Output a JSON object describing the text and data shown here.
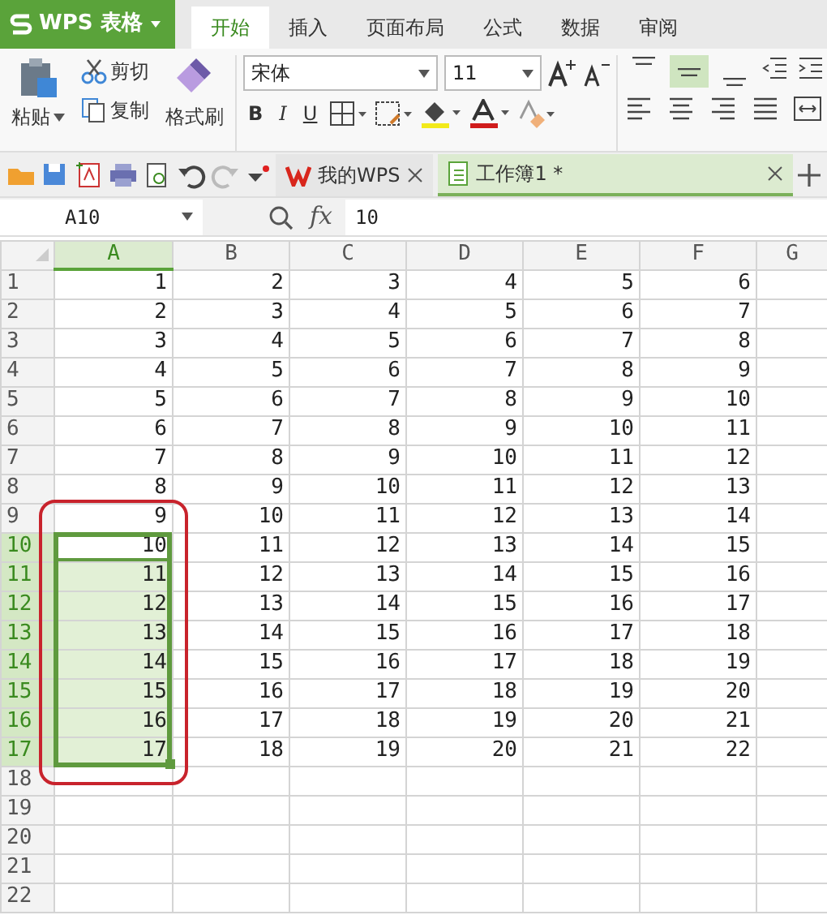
{
  "app_menu": {
    "label": "WPS 表格"
  },
  "ribbon_tabs": [
    {
      "label": "开始",
      "selected": true
    },
    {
      "label": "插入",
      "selected": false
    },
    {
      "label": "页面布局",
      "selected": false
    },
    {
      "label": "公式",
      "selected": false
    },
    {
      "label": "数据",
      "selected": false
    },
    {
      "label": "审阅",
      "selected": false
    }
  ],
  "clipboard": {
    "paste": "粘贴",
    "cut": "剪切",
    "copy": "复制",
    "format_painter": "格式刷"
  },
  "font": {
    "name": "宋体",
    "size": "11",
    "bold": "B",
    "italic": "I",
    "underline": "U"
  },
  "vertical_align": [
    {
      "kind": "top",
      "selected": false
    },
    {
      "kind": "middle",
      "selected": true
    },
    {
      "kind": "bottom",
      "selected": false
    }
  ],
  "doc_tabs": [
    {
      "label": "我的WPS",
      "selected": false
    },
    {
      "label": "工作簿1 *",
      "selected": true
    }
  ],
  "formula_bar": {
    "name_box": "A10",
    "fx": "fx",
    "value": "10"
  },
  "sheet": {
    "columns": [
      {
        "label": "A",
        "selected": true
      },
      {
        "label": "B",
        "selected": false
      },
      {
        "label": "C",
        "selected": false
      },
      {
        "label": "D",
        "selected": false
      },
      {
        "label": "E",
        "selected": false
      },
      {
        "label": "F",
        "selected": false
      },
      {
        "label": "G",
        "selected": false
      }
    ],
    "rows": [
      {
        "number": "1",
        "selected": false,
        "cells": [
          "1",
          "2",
          "3",
          "4",
          "5",
          "6"
        ]
      },
      {
        "number": "2",
        "selected": false,
        "cells": [
          "2",
          "3",
          "4",
          "5",
          "6",
          "7"
        ]
      },
      {
        "number": "3",
        "selected": false,
        "cells": [
          "3",
          "4",
          "5",
          "6",
          "7",
          "8"
        ]
      },
      {
        "number": "4",
        "selected": false,
        "cells": [
          "4",
          "5",
          "6",
          "7",
          "8",
          "9"
        ]
      },
      {
        "number": "5",
        "selected": false,
        "cells": [
          "5",
          "6",
          "7",
          "8",
          "9",
          "10"
        ]
      },
      {
        "number": "6",
        "selected": false,
        "cells": [
          "6",
          "7",
          "8",
          "9",
          "10",
          "11"
        ]
      },
      {
        "number": "7",
        "selected": false,
        "cells": [
          "7",
          "8",
          "9",
          "10",
          "11",
          "12"
        ]
      },
      {
        "number": "8",
        "selected": false,
        "cells": [
          "8",
          "9",
          "10",
          "11",
          "12",
          "13"
        ]
      },
      {
        "number": "9",
        "selected": false,
        "cells": [
          "9",
          "10",
          "11",
          "12",
          "13",
          "14"
        ]
      },
      {
        "number": "10",
        "selected": true,
        "cells": [
          "10",
          "11",
          "12",
          "13",
          "14",
          "15"
        ]
      },
      {
        "number": "11",
        "selected": true,
        "cells": [
          "11",
          "12",
          "13",
          "14",
          "15",
          "16"
        ]
      },
      {
        "number": "12",
        "selected": true,
        "cells": [
          "12",
          "13",
          "14",
          "15",
          "16",
          "17"
        ]
      },
      {
        "number": "13",
        "selected": true,
        "cells": [
          "13",
          "14",
          "15",
          "16",
          "17",
          "18"
        ]
      },
      {
        "number": "14",
        "selected": true,
        "cells": [
          "14",
          "15",
          "16",
          "17",
          "18",
          "19"
        ]
      },
      {
        "number": "15",
        "selected": true,
        "cells": [
          "15",
          "16",
          "17",
          "18",
          "19",
          "20"
        ]
      },
      {
        "number": "16",
        "selected": true,
        "cells": [
          "16",
          "17",
          "18",
          "19",
          "20",
          "21"
        ]
      },
      {
        "number": "17",
        "selected": true,
        "cells": [
          "17",
          "18",
          "19",
          "20",
          "21",
          "22"
        ]
      },
      {
        "number": "18",
        "selected": false
      },
      {
        "number": "19",
        "selected": false
      },
      {
        "number": "20",
        "selected": false
      },
      {
        "number": "21",
        "selected": false
      },
      {
        "number": "22",
        "selected": false
      }
    ]
  }
}
